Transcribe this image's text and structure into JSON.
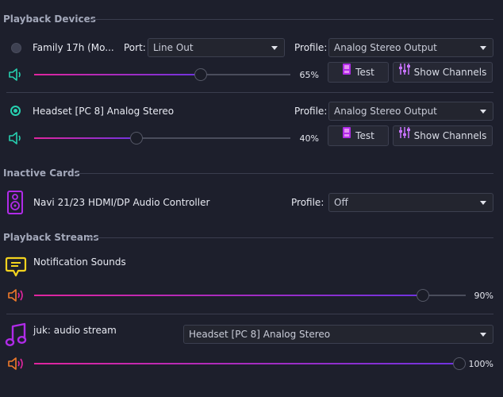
{
  "playback_devices": {
    "title": "Playback Devices",
    "devices": [
      {
        "name": "Family 17h (Mo...",
        "port_label": "Port:",
        "port_value": "Line Out",
        "profile_label": "Profile:",
        "profile_value": "Analog Stereo Output",
        "volume": 65,
        "volume_text": "65%",
        "test_label": "Test",
        "channels_label": "Show Channels",
        "default": false
      },
      {
        "name": "Headset [PC 8] Analog Stereo",
        "profile_label": "Profile:",
        "profile_value": "Analog Stereo Output",
        "volume": 40,
        "volume_text": "40%",
        "test_label": "Test",
        "channels_label": "Show Channels",
        "default": true
      }
    ]
  },
  "inactive_cards": {
    "title": "Inactive Cards",
    "cards": [
      {
        "name": "Navi 21/23 HDMI/DP Audio Controller",
        "profile_label": "Profile:",
        "profile_value": "Off"
      }
    ]
  },
  "playback_streams": {
    "title": "Playback Streams",
    "streams": [
      {
        "name": "Notification Sounds",
        "volume": 90,
        "volume_text": "90%"
      },
      {
        "name": "juk: audio stream",
        "device_value": "Headset [PC 8] Analog Stereo",
        "volume": 100,
        "volume_text": "100%"
      }
    ]
  },
  "colors": {
    "accent_teal": "#27d0b0",
    "slider_pink": "#e0259e",
    "slider_purple": "#6f33e0",
    "notification_yellow": "#f2d21e",
    "music_purple": "#b02be8"
  }
}
